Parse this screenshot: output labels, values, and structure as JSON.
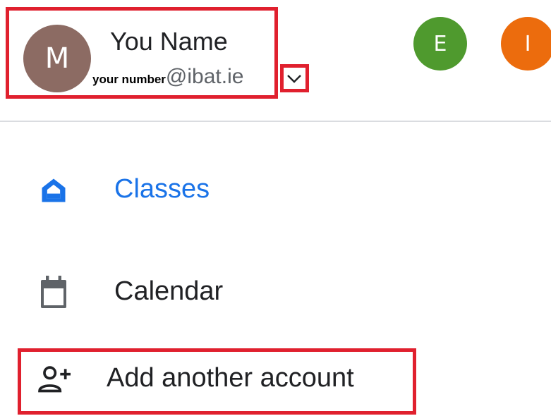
{
  "account": {
    "avatar_initial": "M",
    "name": "You Name",
    "email_prefix": "your number",
    "email_domain": "@ibat.ie",
    "expand_icon": "chevron-down-icon"
  },
  "other_accounts": [
    {
      "initial": "E",
      "color": "#4f9a2e"
    },
    {
      "initial": "I",
      "color": "#ec6c0d"
    }
  ],
  "nav": {
    "classes": {
      "label": "Classes",
      "icon": "home-icon"
    },
    "calendar": {
      "label": "Calendar",
      "icon": "calendar-icon"
    },
    "add_account": {
      "label": "Add another account",
      "icon": "add-person-icon"
    }
  },
  "colors": {
    "accent": "#1a73e8",
    "annotation": "#e0202e",
    "avatar": "#8c6b63"
  }
}
